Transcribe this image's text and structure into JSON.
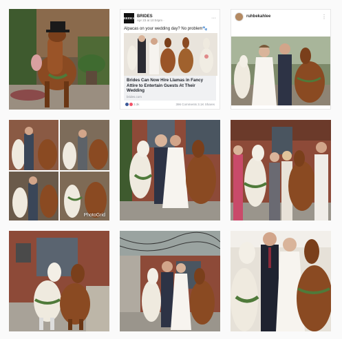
{
  "grid": {
    "tiles": [
      {
        "name": "photo-llama-top-hat",
        "kind": "photo"
      },
      {
        "name": "facebook-post-brides",
        "kind": "facebook"
      },
      {
        "name": "instagram-post-ruhbekahlee",
        "kind": "instagram"
      },
      {
        "name": "photo-collage-photogrid",
        "kind": "collage"
      },
      {
        "name": "photo-couple-alpaca-llama",
        "kind": "photo"
      },
      {
        "name": "photo-bridesmaids-alpacas",
        "kind": "photo"
      },
      {
        "name": "photo-alpacas-porch",
        "kind": "photo"
      },
      {
        "name": "photo-couple-string-lights",
        "kind": "photo"
      },
      {
        "name": "photo-couple-closeup",
        "kind": "photo"
      }
    ]
  },
  "facebook_post": {
    "page_logo": "BRIDES",
    "page_name": "BRIDES",
    "timestamp": "Apr 23 at 10:04pm · ",
    "text": "Alpacas on your wedding day? No problem🐾",
    "headline": "Brides Can Now Hire Llamas in Fancy Attire to Entertain Guests At Their Wedding",
    "domain": "brides.com",
    "reactions": "3.3k",
    "comments_shares": "396 Comments 3.1K Shares",
    "menu_icon": "more-icon"
  },
  "instagram_post": {
    "username": "ruhbekahlee",
    "menu_icon": "more-vertical-icon"
  },
  "collage": {
    "watermark": "PhotoGrid"
  },
  "colors": {
    "background": "#fafafa",
    "facebook_like": "#3b5998",
    "facebook_love": "#f25268",
    "llama_brown": "#8a4a22",
    "alpaca_white": "#efeadf",
    "brick": "#8d4a38"
  }
}
